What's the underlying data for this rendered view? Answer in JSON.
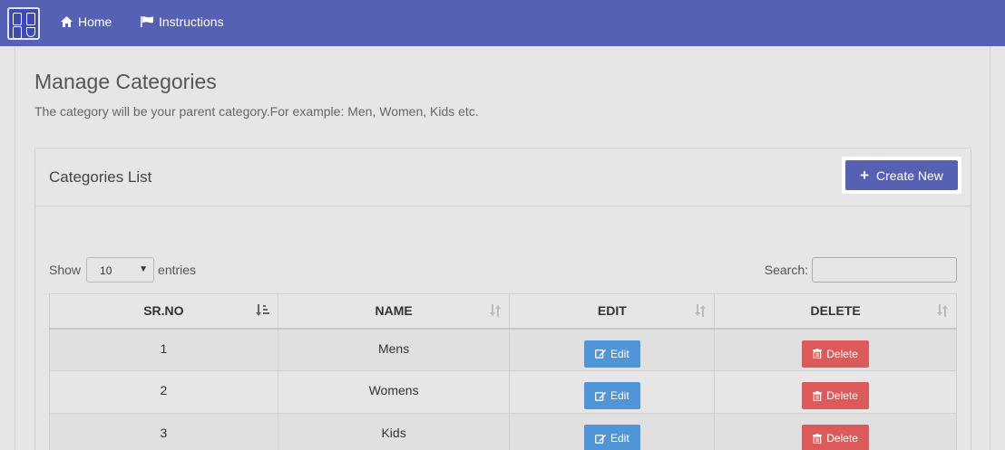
{
  "nav": {
    "home_label": "Home",
    "instructions_label": "Instructions"
  },
  "page": {
    "title": "Manage Categories",
    "description": "The category will be your parent category.For example: Men, Women, Kids etc."
  },
  "panel": {
    "title": "Categories List",
    "create_label": "Create New"
  },
  "controls": {
    "show_label": "Show",
    "entries_value": "10",
    "entries_label": "entries",
    "search_label": "Search:",
    "search_value": ""
  },
  "table": {
    "headers": [
      "SR.NO",
      "NAME",
      "EDIT",
      "DELETE"
    ],
    "rows": [
      {
        "sr": "1",
        "name": "Mens",
        "edit": "Edit",
        "delete": "Delete"
      },
      {
        "sr": "2",
        "name": "Womens",
        "edit": "Edit",
        "delete": "Delete"
      },
      {
        "sr": "3",
        "name": "Kids",
        "edit": "Edit",
        "delete": "Delete"
      }
    ]
  },
  "colors": {
    "navbar": "#5661b3",
    "primary_button": "#5661b3",
    "edit_button": "#4f95d8",
    "delete_button": "#dc5a5a",
    "background": "#e6e6e6"
  },
  "icons": {
    "logo": "app-logo-icon",
    "home": "home-icon",
    "instructions": "flag-icon",
    "create": "plus-icon",
    "edit": "edit-icon",
    "delete": "trash-icon",
    "sort_active": "sort-amount-down-icon",
    "sort": "sort-icon"
  }
}
